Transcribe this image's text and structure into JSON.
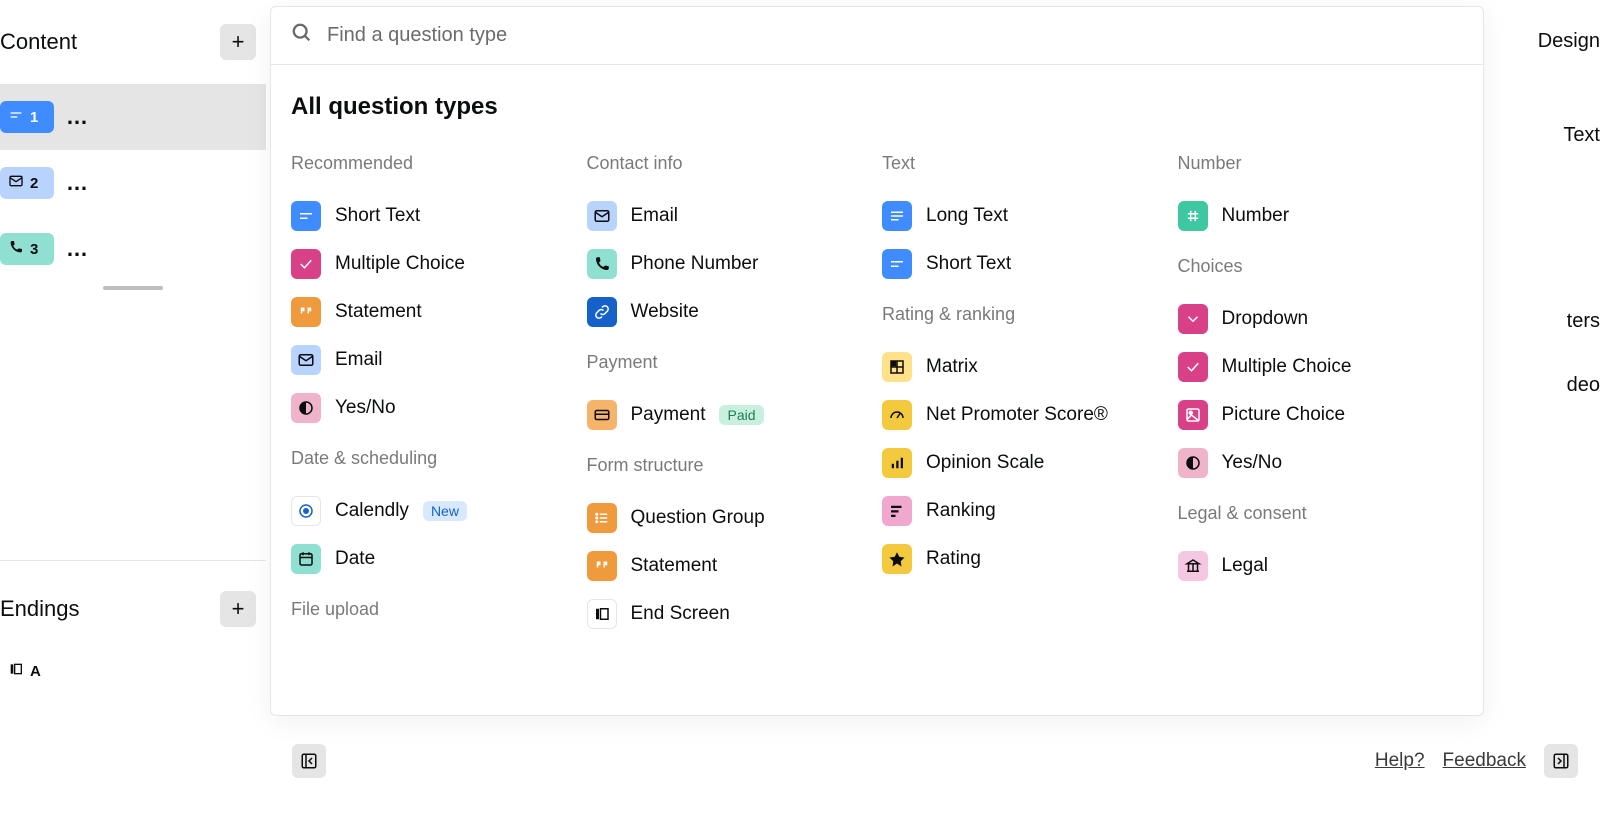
{
  "sidebar": {
    "content_label": "Content",
    "endings_label": "Endings",
    "add_plus": "+",
    "dots": "…",
    "items": [
      {
        "num": "1",
        "icon": "short-text",
        "pill": "pill-blue",
        "active": true
      },
      {
        "num": "2",
        "icon": "email",
        "pill": "pill-lblue",
        "active": false
      },
      {
        "num": "3",
        "icon": "phone",
        "pill": "pill-mint",
        "active": false
      }
    ],
    "ending_item": {
      "letter": "A",
      "icon": "end-screen"
    }
  },
  "right_strip": {
    "design": "Design",
    "text": "Text",
    "ters": "ters",
    "deo": "deo"
  },
  "modal": {
    "search_placeholder": "Find a question type",
    "title": "All question types",
    "columns": [
      {
        "groups": [
          {
            "header": "Recommended",
            "items": [
              {
                "label": "Short Text",
                "icon": "short-text",
                "cls": "blue"
              },
              {
                "label": "Multiple Choice",
                "icon": "check",
                "cls": "magenta"
              },
              {
                "label": "Statement",
                "icon": "quote",
                "cls": "orange"
              },
              {
                "label": "Email",
                "icon": "email",
                "cls": "lblue"
              },
              {
                "label": "Yes/No",
                "icon": "half-circle",
                "cls": "lpink2"
              }
            ]
          },
          {
            "header": "Date & scheduling",
            "items": [
              {
                "label": "Calendly",
                "icon": "calendly",
                "cls": "white",
                "badge": "New",
                "badge_cls": "new"
              },
              {
                "label": "Date",
                "icon": "date",
                "cls": "mint"
              }
            ]
          },
          {
            "header": "File upload",
            "items": []
          }
        ]
      },
      {
        "groups": [
          {
            "header": "Contact info",
            "items": [
              {
                "label": "Email",
                "icon": "email",
                "cls": "lblue"
              },
              {
                "label": "Phone Number",
                "icon": "phone",
                "cls": "mint"
              },
              {
                "label": "Website",
                "icon": "link",
                "cls": "link"
              }
            ]
          },
          {
            "header": "Payment",
            "items": [
              {
                "label": "Payment",
                "icon": "card",
                "cls": "lorange",
                "badge": "Paid",
                "badge_cls": "paid"
              }
            ]
          },
          {
            "header": "Form structure",
            "items": [
              {
                "label": "Question Group",
                "icon": "list",
                "cls": "orange"
              },
              {
                "label": "Statement",
                "icon": "quote",
                "cls": "orange"
              },
              {
                "label": "End Screen",
                "icon": "end-screen",
                "cls": "white"
              }
            ]
          }
        ]
      },
      {
        "groups": [
          {
            "header": "Text",
            "items": [
              {
                "label": "Long Text",
                "icon": "long-text",
                "cls": "blue"
              },
              {
                "label": "Short Text",
                "icon": "short-text",
                "cls": "blue"
              }
            ]
          },
          {
            "header": "Rating & ranking",
            "items": [
              {
                "label": "Matrix",
                "icon": "matrix",
                "cls": "lyellow"
              },
              {
                "label": "Net Promoter Score®",
                "icon": "gauge",
                "cls": "yellow"
              },
              {
                "label": "Opinion Scale",
                "icon": "bars",
                "cls": "yellow"
              },
              {
                "label": "Ranking",
                "icon": "ranking",
                "cls": "pink"
              },
              {
                "label": "Rating",
                "icon": "star",
                "cls": "yellow"
              }
            ]
          }
        ]
      },
      {
        "groups": [
          {
            "header": "Number",
            "items": [
              {
                "label": "Number",
                "icon": "hash",
                "cls": "teal"
              }
            ]
          },
          {
            "header": "Choices",
            "items": [
              {
                "label": "Dropdown",
                "icon": "chevron-down",
                "cls": "magenta"
              },
              {
                "label": "Multiple Choice",
                "icon": "check",
                "cls": "magenta"
              },
              {
                "label": "Picture Choice",
                "icon": "picture",
                "cls": "magenta"
              },
              {
                "label": "Yes/No",
                "icon": "half-circle",
                "cls": "lpink2"
              }
            ]
          },
          {
            "header": "Legal & consent",
            "items": [
              {
                "label": "Legal",
                "icon": "bank",
                "cls": "lightpink"
              }
            ]
          }
        ]
      }
    ]
  },
  "footer": {
    "help": "Help?",
    "feedback": "Feedback"
  }
}
